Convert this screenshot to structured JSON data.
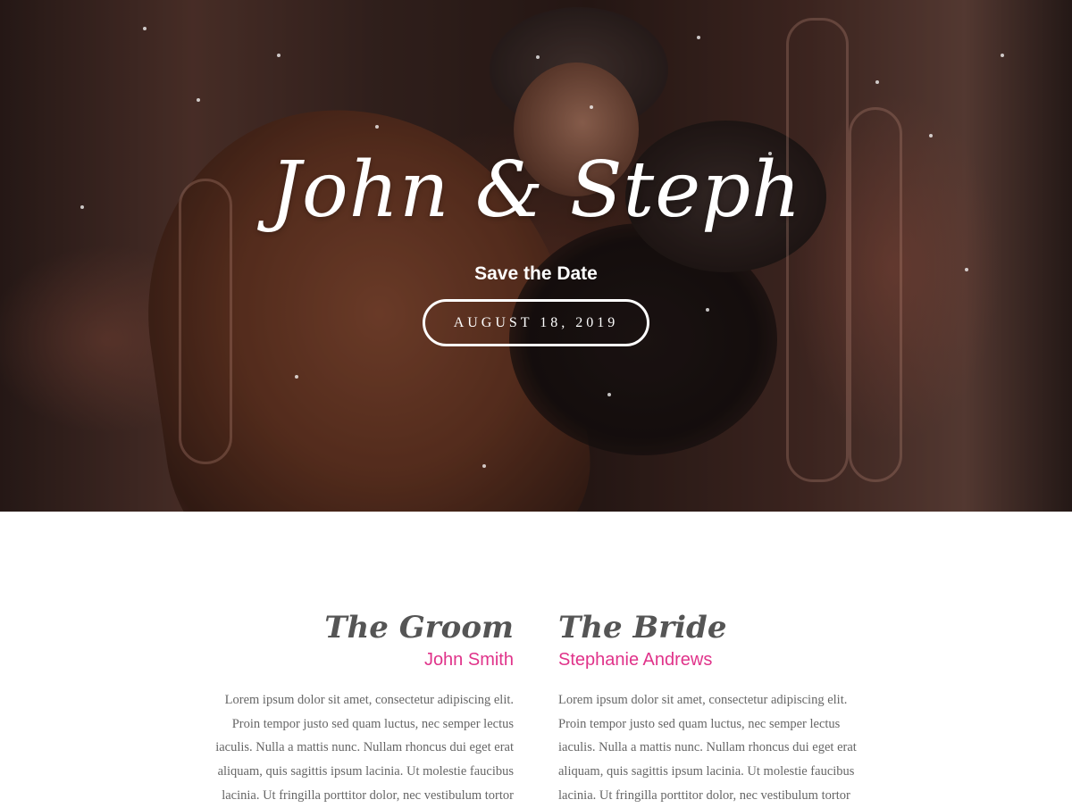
{
  "hero": {
    "title": "John & Steph",
    "subtitle": "Save the Date",
    "date_button": "AUGUST 18, 2019"
  },
  "groom": {
    "heading": "The Groom",
    "name": "John Smith",
    "bio_lines": [
      "Lorem ipsum dolor sit amet, consectetur adipiscing elit.",
      "Proin tempor justo sed quam luctus, nec semper lectus",
      "iaculis. Nulla a mattis nunc. Nullam rhoncus dui eget erat",
      "aliquam, quis sagittis ipsum lacinia. Ut molestie faucibus",
      "lacinia. Ut fringilla porttitor dolor, nec vestibulum tortor"
    ]
  },
  "bride": {
    "heading": "The Bride",
    "name": "Stephanie Andrews",
    "bio_lines": [
      "Lorem ipsum dolor sit amet, consectetur adipiscing elit.",
      "Proin tempor justo sed quam luctus, nec semper lectus",
      "iaculis. Nulla a mattis nunc. Nullam rhoncus dui eget erat",
      "aliquam, quis sagittis ipsum lacinia. Ut molestie faucibus",
      "lacinia. Ut fringilla porttitor dolor, nec vestibulum tortor"
    ]
  },
  "colors": {
    "accent": "#e0338a",
    "heading": "#555555",
    "body_text": "#666666"
  }
}
